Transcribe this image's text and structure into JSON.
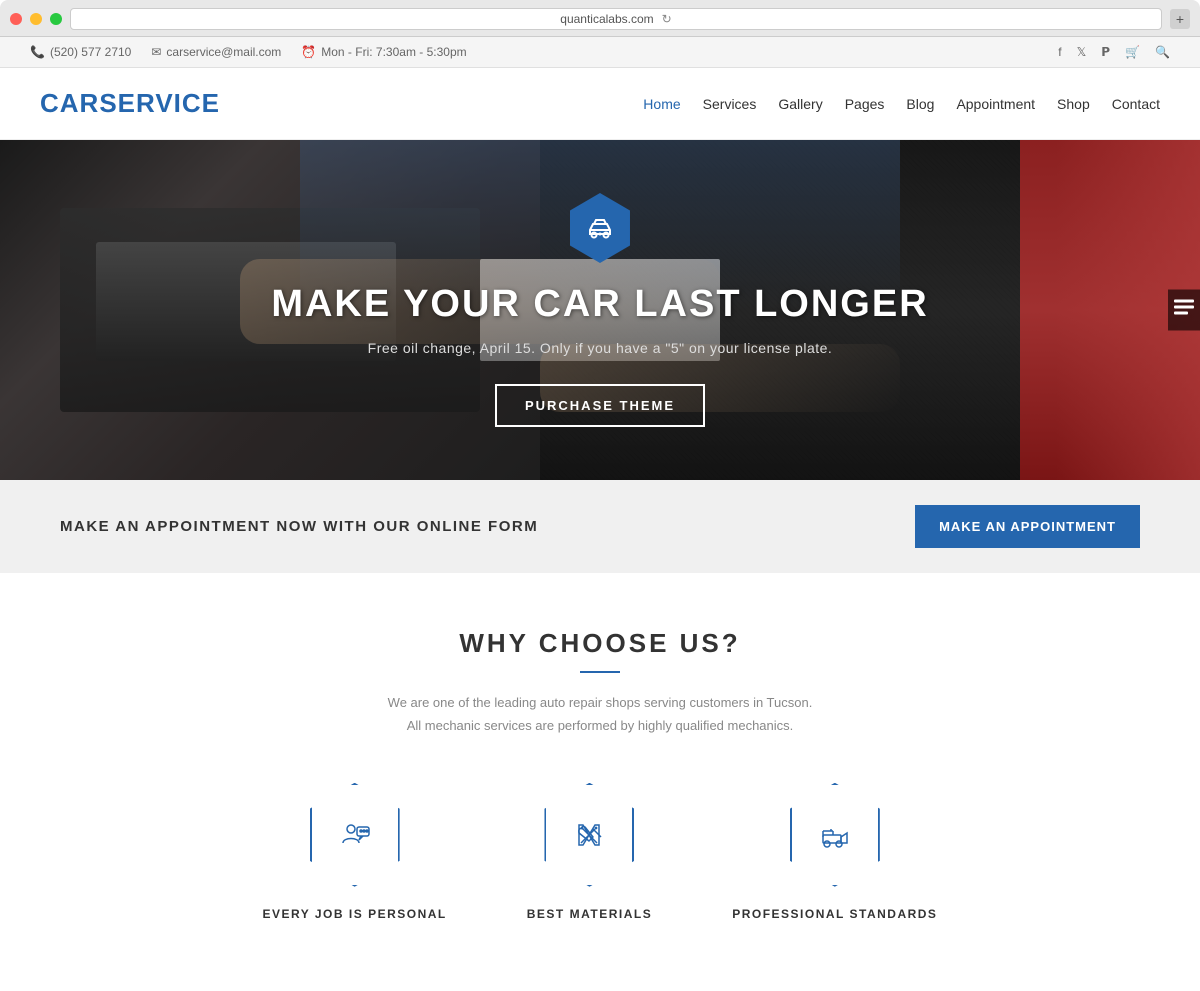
{
  "browser": {
    "url": "quanticalabs.com",
    "new_tab_label": "+"
  },
  "topbar": {
    "phone": "(520) 577 2710",
    "email": "carservice@mail.com",
    "hours": "Mon - Fri: 7:30am - 5:30pm"
  },
  "header": {
    "logo": "CARSERVICE",
    "nav": {
      "items": [
        {
          "label": "Home",
          "active": true
        },
        {
          "label": "Services",
          "active": false
        },
        {
          "label": "Gallery",
          "active": false
        },
        {
          "label": "Pages",
          "active": false
        },
        {
          "label": "Blog",
          "active": false
        },
        {
          "label": "Appointment",
          "active": false
        },
        {
          "label": "Shop",
          "active": false
        },
        {
          "label": "Contact",
          "active": false
        }
      ]
    }
  },
  "hero": {
    "title": "MAKE YOUR CAR LAST LONGER",
    "subtitle": "Free oil change, April 15. Only if you have a \"5\" on your license plate.",
    "button_label": "PURCHASE THEME"
  },
  "appointment_banner": {
    "text": "MAKE AN APPOINTMENT NOW WITH OUR ONLINE FORM",
    "button_label": "MAKE AN APPOINTMENT"
  },
  "why_section": {
    "title": "WHY CHOOSE US?",
    "subtitle_line1": "We are one of the leading auto repair shops serving customers in Tucson.",
    "subtitle_line2": "All mechanic services are performed by highly qualified mechanics.",
    "features": [
      {
        "label": "EVERY JOB IS PERSONAL",
        "icon": "person-chat"
      },
      {
        "label": "BEST MATERIALS",
        "icon": "tools-cross"
      },
      {
        "label": "PROFESSIONAL STANDARDS",
        "icon": "tow-truck"
      }
    ]
  },
  "colors": {
    "brand_blue": "#2566ae",
    "text_dark": "#333333",
    "text_light": "#888888"
  }
}
